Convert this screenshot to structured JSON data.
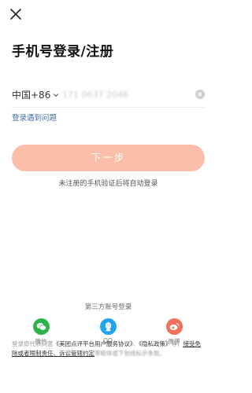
{
  "colors": {
    "accent_light": "#fbbfa9",
    "link_blue": "#3c6ea5",
    "wechat_green": "#2fb349",
    "qq_blue": "#21a5ef",
    "weibo_orange": "#f0705a"
  },
  "header": {
    "close_icon": "close-icon",
    "title": "手机号登录/注册"
  },
  "phone": {
    "country_code": "中国+86",
    "placeholder": "",
    "value": "171 0637 2046",
    "clear_icon": "clear-icon"
  },
  "trouble_link": "登录遇到问题",
  "next_button": "下一步",
  "auto_hint": "未注册的手机验证后将自动登录",
  "third_party": {
    "title": "第三方账号登录",
    "items": [
      {
        "label": "微信",
        "icon": "wechat-icon"
      },
      {
        "label": "QQ",
        "icon": "qq-icon"
      },
      {
        "label": "微博",
        "icon": "weibo-icon"
      }
    ]
  },
  "agreement": {
    "prefix": "登录即代表同意",
    "link1": "《美团点评平台用户服务协议》",
    "sep": "、",
    "link2": "《隐私政策》",
    "middle": "等，",
    "link3": "接受免除或者限制责任、诉讼管辖约定",
    "suffix": "等粗体或下划线标示条款。"
  }
}
